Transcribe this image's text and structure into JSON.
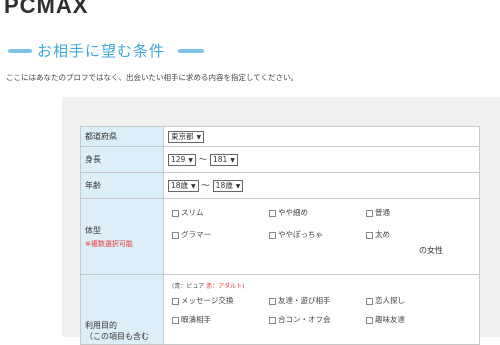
{
  "logo": "PCMAX",
  "page_title": "お相手に望む条件",
  "subtitle": "ここにはあなたのプロフではなく、出会いたい相手に求める内容を指定してください。",
  "form": {
    "prefecture": {
      "label": "都道府県",
      "value": "東京都"
    },
    "height": {
      "label": "身長",
      "min": "129",
      "max": "181",
      "separator": "～"
    },
    "age": {
      "label": "年齢",
      "min": "18歳",
      "max": "18歳",
      "separator": "～"
    },
    "body_type": {
      "label": "体型",
      "note": "※複数選択可能",
      "options": [
        "スリム",
        "やや細め",
        "普通",
        "グラマー",
        "ややぽっちゃ",
        "太め"
      ],
      "suffix": "の女性"
    },
    "purpose": {
      "label": "利用目的",
      "label_sub": "（この項目も含む",
      "legend_blue": "(青：ピュア",
      "legend_pink": "赤：アダルト)",
      "options": [
        "メッセージ交換",
        "友達・遊び相手",
        "恋人探し",
        "暇潰相手",
        "合コン・オフ会",
        "趣味友達"
      ]
    }
  },
  "colors": {
    "accent": "#3fa7dd",
    "label_bg": "#dceef8",
    "note": "#e33333"
  }
}
